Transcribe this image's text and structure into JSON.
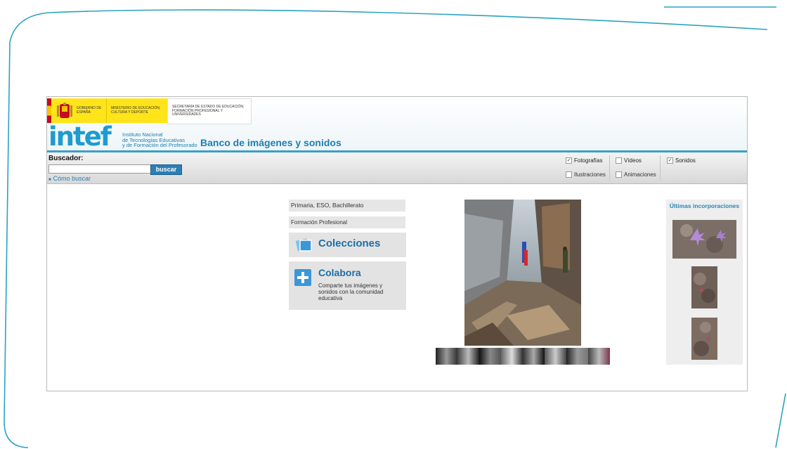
{
  "header": {
    "gov_text_1": "GOBIERNO DE ESPAÑA",
    "gov_text_2": "MINISTERIO DE EDUCACIÓN, CULTURA Y DEPORTE",
    "gov_text_3": "SECRETARÍA DE ESTADO DE EDUCACIÓN, FORMACIÓN PROFESIONAL Y UNIVERSIDADES",
    "logo": "intef",
    "institute": [
      "Instituto Nacional",
      "de Tecnologías Educativas",
      "y de Formación del Profesorado"
    ],
    "site_title": "Banco de imágenes y sonidos"
  },
  "search": {
    "label": "Buscador:",
    "value": "",
    "button": "buscar",
    "help_link": "Cómo buscar",
    "filters": [
      {
        "label": "Fotografías",
        "checked": true
      },
      {
        "label": "Vídeos",
        "checked": false
      },
      {
        "label": "Sonidos",
        "checked": true
      },
      {
        "label": "Ilustraciones",
        "checked": false
      },
      {
        "label": "Animaciones",
        "checked": false
      }
    ]
  },
  "menu": {
    "level1": "Primaria, ESO, Bachillerato",
    "level2": "Formación Profesional",
    "collections": "Colecciones",
    "collaborate": "Colabora",
    "collaborate_desc": "Comparte tus imágenes y sonidos con la comunidad educativa"
  },
  "sidebar": {
    "title": "Últimas incorporaciones"
  },
  "colors": {
    "frame": "#2aa3c0",
    "brand": "#1e9bd0",
    "link": "#1b6fa6"
  }
}
